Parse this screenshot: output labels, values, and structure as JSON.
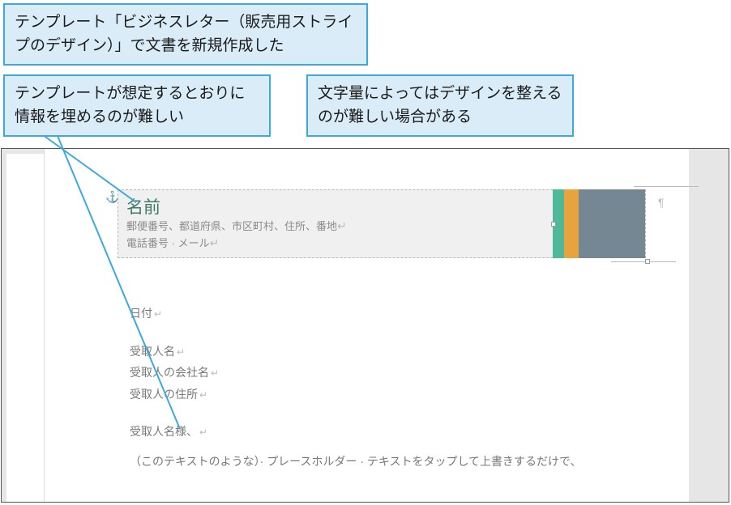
{
  "callouts": {
    "c1": "テンプレート「ビジネスレター（販売用ストライプのデザイン）」で文書を新規作成した",
    "c2": "テンプレートが想定するとおりに情報を埋めるのが難しい",
    "c3": "文字量によってはデザインを整えるのが難しい場合がある"
  },
  "header": {
    "name": "名前",
    "address": "郵便番号、都道府県、市区町村、住所、番地",
    "contact": "電話番号 · メール"
  },
  "stripes": {
    "green": "#4fb89a",
    "orange": "#e6a33e",
    "gray": "#748792"
  },
  "body": {
    "date": "日付",
    "recipient_name": "受取人名",
    "recipient_company": "受取人の会社名",
    "recipient_address": "受取人の住所",
    "salutation": "受取人名様、",
    "paragraph": "（このテキストのような）· プレースホルダー · テキストをタップして上書きするだけで、"
  }
}
